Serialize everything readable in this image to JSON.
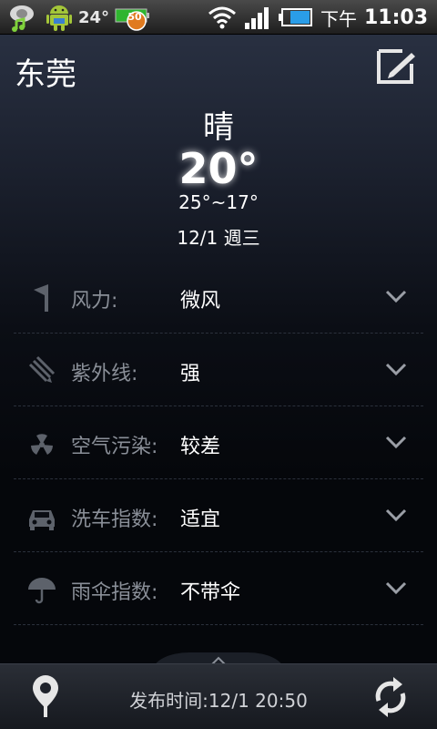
{
  "status_bar": {
    "temperature": "24°",
    "battery_badge": "50",
    "ampm": "下午",
    "time": "11:03",
    "icons": [
      "weather-icon",
      "music-icon",
      "android-icon",
      "battery-notify-icon",
      "wifi-icon",
      "signal-icon",
      "battery-icon"
    ]
  },
  "header": {
    "city": "东莞",
    "edit_icon": "edit-icon"
  },
  "current": {
    "condition": "晴",
    "temperature": "20°",
    "range": "25°~17°",
    "date": "12/1 週三"
  },
  "details": [
    {
      "icon": "flag-icon",
      "label": "风力:",
      "value": "微风"
    },
    {
      "icon": "uv-icon",
      "label": "紫外线:",
      "value": "强"
    },
    {
      "icon": "radiation-icon",
      "label": "空气污染:",
      "value": "较差"
    },
    {
      "icon": "car-icon",
      "label": "洗车指数:",
      "value": "适宜"
    },
    {
      "icon": "umbrella-icon",
      "label": "雨伞指数:",
      "value": "不带伞"
    }
  ],
  "bottom_bar": {
    "publish_time": "发布时间:12/1 20:50",
    "location_icon": "location-pin-icon",
    "refresh_icon": "refresh-icon"
  },
  "colors": {
    "label_gray": "#8a8f98",
    "icon_gray": "#5d626b",
    "divider": "#2b313c"
  }
}
